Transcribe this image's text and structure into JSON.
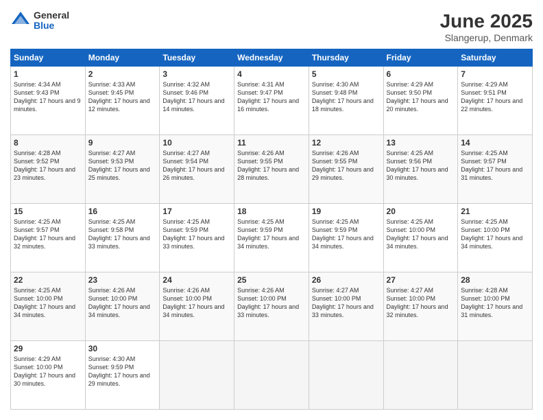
{
  "header": {
    "logo_general": "General",
    "logo_blue": "Blue",
    "month_title": "June 2025",
    "location": "Slangerup, Denmark"
  },
  "days_of_week": [
    "Sunday",
    "Monday",
    "Tuesday",
    "Wednesday",
    "Thursday",
    "Friday",
    "Saturday"
  ],
  "weeks": [
    [
      {
        "day": "1",
        "sunrise": "4:34 AM",
        "sunset": "9:43 PM",
        "daylight": "17 hours and 9 minutes."
      },
      {
        "day": "2",
        "sunrise": "4:33 AM",
        "sunset": "9:45 PM",
        "daylight": "17 hours and 12 minutes."
      },
      {
        "day": "3",
        "sunrise": "4:32 AM",
        "sunset": "9:46 PM",
        "daylight": "17 hours and 14 minutes."
      },
      {
        "day": "4",
        "sunrise": "4:31 AM",
        "sunset": "9:47 PM",
        "daylight": "17 hours and 16 minutes."
      },
      {
        "day": "5",
        "sunrise": "4:30 AM",
        "sunset": "9:48 PM",
        "daylight": "17 hours and 18 minutes."
      },
      {
        "day": "6",
        "sunrise": "4:29 AM",
        "sunset": "9:50 PM",
        "daylight": "17 hours and 20 minutes."
      },
      {
        "day": "7",
        "sunrise": "4:29 AM",
        "sunset": "9:51 PM",
        "daylight": "17 hours and 22 minutes."
      }
    ],
    [
      {
        "day": "8",
        "sunrise": "4:28 AM",
        "sunset": "9:52 PM",
        "daylight": "17 hours and 23 minutes."
      },
      {
        "day": "9",
        "sunrise": "4:27 AM",
        "sunset": "9:53 PM",
        "daylight": "17 hours and 25 minutes."
      },
      {
        "day": "10",
        "sunrise": "4:27 AM",
        "sunset": "9:54 PM",
        "daylight": "17 hours and 26 minutes."
      },
      {
        "day": "11",
        "sunrise": "4:26 AM",
        "sunset": "9:55 PM",
        "daylight": "17 hours and 28 minutes."
      },
      {
        "day": "12",
        "sunrise": "4:26 AM",
        "sunset": "9:55 PM",
        "daylight": "17 hours and 29 minutes."
      },
      {
        "day": "13",
        "sunrise": "4:25 AM",
        "sunset": "9:56 PM",
        "daylight": "17 hours and 30 minutes."
      },
      {
        "day": "14",
        "sunrise": "4:25 AM",
        "sunset": "9:57 PM",
        "daylight": "17 hours and 31 minutes."
      }
    ],
    [
      {
        "day": "15",
        "sunrise": "4:25 AM",
        "sunset": "9:57 PM",
        "daylight": "17 hours and 32 minutes."
      },
      {
        "day": "16",
        "sunrise": "4:25 AM",
        "sunset": "9:58 PM",
        "daylight": "17 hours and 33 minutes."
      },
      {
        "day": "17",
        "sunrise": "4:25 AM",
        "sunset": "9:59 PM",
        "daylight": "17 hours and 33 minutes."
      },
      {
        "day": "18",
        "sunrise": "4:25 AM",
        "sunset": "9:59 PM",
        "daylight": "17 hours and 34 minutes."
      },
      {
        "day": "19",
        "sunrise": "4:25 AM",
        "sunset": "9:59 PM",
        "daylight": "17 hours and 34 minutes."
      },
      {
        "day": "20",
        "sunrise": "4:25 AM",
        "sunset": "10:00 PM",
        "daylight": "17 hours and 34 minutes."
      },
      {
        "day": "21",
        "sunrise": "4:25 AM",
        "sunset": "10:00 PM",
        "daylight": "17 hours and 34 minutes."
      }
    ],
    [
      {
        "day": "22",
        "sunrise": "4:25 AM",
        "sunset": "10:00 PM",
        "daylight": "17 hours and 34 minutes."
      },
      {
        "day": "23",
        "sunrise": "4:26 AM",
        "sunset": "10:00 PM",
        "daylight": "17 hours and 34 minutes."
      },
      {
        "day": "24",
        "sunrise": "4:26 AM",
        "sunset": "10:00 PM",
        "daylight": "17 hours and 34 minutes."
      },
      {
        "day": "25",
        "sunrise": "4:26 AM",
        "sunset": "10:00 PM",
        "daylight": "17 hours and 33 minutes."
      },
      {
        "day": "26",
        "sunrise": "4:27 AM",
        "sunset": "10:00 PM",
        "daylight": "17 hours and 33 minutes."
      },
      {
        "day": "27",
        "sunrise": "4:27 AM",
        "sunset": "10:00 PM",
        "daylight": "17 hours and 32 minutes."
      },
      {
        "day": "28",
        "sunrise": "4:28 AM",
        "sunset": "10:00 PM",
        "daylight": "17 hours and 31 minutes."
      }
    ],
    [
      {
        "day": "29",
        "sunrise": "4:29 AM",
        "sunset": "10:00 PM",
        "daylight": "17 hours and 30 minutes."
      },
      {
        "day": "30",
        "sunrise": "4:30 AM",
        "sunset": "9:59 PM",
        "daylight": "17 hours and 29 minutes."
      },
      null,
      null,
      null,
      null,
      null
    ]
  ]
}
